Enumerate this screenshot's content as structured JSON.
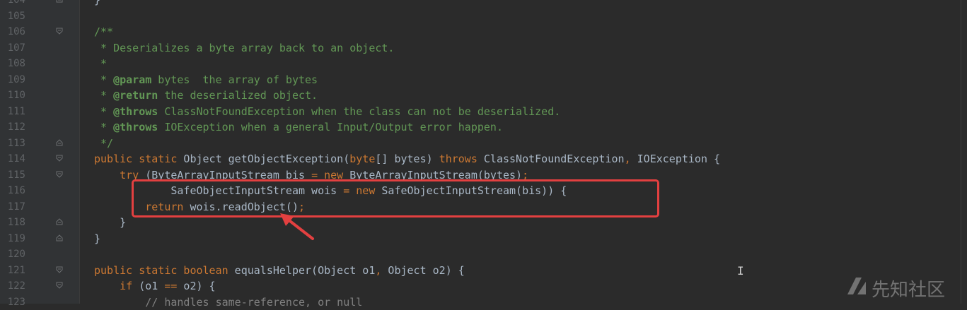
{
  "editor": {
    "lines": [
      {
        "num": "104",
        "fold": "end",
        "indent": "",
        "tokens": [
          {
            "t": "}",
            "c": "plain"
          }
        ]
      },
      {
        "num": "105",
        "fold": "",
        "indent": "",
        "tokens": []
      },
      {
        "num": "106",
        "fold": "start",
        "indent": "",
        "tokens": [
          {
            "t": "/**",
            "c": "doc"
          }
        ]
      },
      {
        "num": "107",
        "fold": "",
        "indent": " ",
        "tokens": [
          {
            "t": "* Deserializes a byte array back to an object.",
            "c": "doc"
          }
        ]
      },
      {
        "num": "108",
        "fold": "",
        "indent": " ",
        "tokens": [
          {
            "t": "*",
            "c": "doc"
          }
        ]
      },
      {
        "num": "109",
        "fold": "",
        "indent": " ",
        "tokens": [
          {
            "t": "* ",
            "c": "doc"
          },
          {
            "t": "@param",
            "c": "tag"
          },
          {
            "t": " bytes  the array of bytes",
            "c": "doc"
          }
        ]
      },
      {
        "num": "110",
        "fold": "",
        "indent": " ",
        "tokens": [
          {
            "t": "* ",
            "c": "doc"
          },
          {
            "t": "@return",
            "c": "tag"
          },
          {
            "t": " the deserialized object.",
            "c": "doc"
          }
        ]
      },
      {
        "num": "111",
        "fold": "",
        "indent": " ",
        "tokens": [
          {
            "t": "* ",
            "c": "doc"
          },
          {
            "t": "@throws",
            "c": "tag"
          },
          {
            "t": " ClassNotFoundException when the class can not be deserialized.",
            "c": "doc"
          }
        ]
      },
      {
        "num": "112",
        "fold": "",
        "indent": " ",
        "tokens": [
          {
            "t": "* ",
            "c": "doc"
          },
          {
            "t": "@throws",
            "c": "tag"
          },
          {
            "t": " IOException when a general Input/Output error happen.",
            "c": "doc"
          }
        ]
      },
      {
        "num": "113",
        "fold": "end",
        "indent": " ",
        "tokens": [
          {
            "t": "*/",
            "c": "doc"
          }
        ]
      },
      {
        "num": "114",
        "fold": "start",
        "indent": "",
        "tokens": [
          {
            "t": "public static",
            "c": "kw"
          },
          {
            "t": " Object getObjectException(",
            "c": "plain"
          },
          {
            "t": "byte",
            "c": "kw"
          },
          {
            "t": "[] bytes) ",
            "c": "plain"
          },
          {
            "t": "throws",
            "c": "kw"
          },
          {
            "t": " ClassNotFoundException",
            "c": "plain"
          },
          {
            "t": ",",
            "c": "op"
          },
          {
            "t": " IOException {",
            "c": "plain"
          }
        ]
      },
      {
        "num": "115",
        "fold": "start",
        "indent": "    ",
        "tokens": [
          {
            "t": "try",
            "c": "kw"
          },
          {
            "t": " (ByteArrayInputStream bis ",
            "c": "plain"
          },
          {
            "t": "=",
            "c": "op"
          },
          {
            "t": " ",
            "c": "plain"
          },
          {
            "t": "new",
            "c": "kw"
          },
          {
            "t": " ByteArrayInputStream(bytes)",
            "c": "plain"
          },
          {
            "t": ";",
            "c": "op"
          }
        ]
      },
      {
        "num": "116",
        "fold": "",
        "indent": "            ",
        "tokens": [
          {
            "t": "SafeObjectInputStream wois ",
            "c": "plain"
          },
          {
            "t": "=",
            "c": "op"
          },
          {
            "t": " ",
            "c": "plain"
          },
          {
            "t": "new",
            "c": "kw"
          },
          {
            "t": " SafeObjectInputStream(bis)) {",
            "c": "plain"
          }
        ]
      },
      {
        "num": "117",
        "fold": "",
        "indent": "        ",
        "tokens": [
          {
            "t": "return",
            "c": "kw"
          },
          {
            "t": " wois.readObject()",
            "c": "plain"
          },
          {
            "t": ";",
            "c": "op"
          }
        ]
      },
      {
        "num": "118",
        "fold": "end",
        "indent": "    ",
        "tokens": [
          {
            "t": "}",
            "c": "plain"
          }
        ]
      },
      {
        "num": "119",
        "fold": "end",
        "indent": "",
        "tokens": [
          {
            "t": "}",
            "c": "plain"
          }
        ]
      },
      {
        "num": "120",
        "fold": "",
        "indent": "",
        "tokens": []
      },
      {
        "num": "121",
        "fold": "start",
        "indent": "",
        "tokens": [
          {
            "t": "public static boolean",
            "c": "kw"
          },
          {
            "t": " equalsHelper(Object o1",
            "c": "plain"
          },
          {
            "t": ",",
            "c": "op"
          },
          {
            "t": " Object o2) {",
            "c": "plain"
          }
        ]
      },
      {
        "num": "122",
        "fold": "start",
        "indent": "    ",
        "tokens": [
          {
            "t": "if",
            "c": "kw"
          },
          {
            "t": " (o1 ",
            "c": "plain"
          },
          {
            "t": "==",
            "c": "op"
          },
          {
            "t": " o2) {",
            "c": "plain"
          }
        ]
      },
      {
        "num": "123",
        "fold": "",
        "indent": "        ",
        "tokens": [
          {
            "t": "// handles same-reference, or null",
            "c": "cmt"
          }
        ]
      }
    ]
  },
  "watermark": {
    "text": "先知社区",
    "icon": "xianzhi-logo-icon"
  },
  "annotation": {
    "color": "#e34040"
  },
  "colors": {
    "background": "#2b2b2b",
    "gutter": "#313335",
    "keyword": "#cc7832",
    "doc": "#629755",
    "text": "#a9b7c6",
    "lineNumber": "#606366"
  }
}
